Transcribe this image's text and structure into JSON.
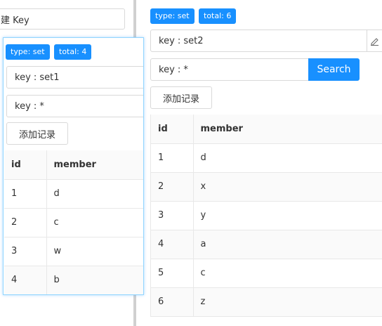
{
  "left_panel": {
    "new_key_label": "建 Key"
  },
  "popup": {
    "type_tag": "type: set",
    "total_tag": "total: 4",
    "key_value": "key : set1",
    "search_value": "key : *",
    "add_button": "添加记录",
    "columns": {
      "id": "id",
      "member": "member"
    },
    "rows": [
      {
        "id": "1",
        "member": "d"
      },
      {
        "id": "2",
        "member": "c"
      },
      {
        "id": "3",
        "member": "w"
      },
      {
        "id": "4",
        "member": "b"
      }
    ]
  },
  "right_panel": {
    "type_tag": "type: set",
    "total_tag": "total: 6",
    "key_value": "key : set2",
    "search_value": "key : *",
    "search_button": "Search",
    "add_button": "添加记录",
    "columns": {
      "id": "id",
      "member": "member"
    },
    "rows": [
      {
        "id": "1",
        "member": "d"
      },
      {
        "id": "2",
        "member": "x"
      },
      {
        "id": "3",
        "member": "y"
      },
      {
        "id": "4",
        "member": "a"
      },
      {
        "id": "5",
        "member": "c"
      },
      {
        "id": "6",
        "member": "z"
      }
    ]
  },
  "icons": {
    "edit": "pencil-edit-icon"
  },
  "colors": {
    "accent": "#1890ff",
    "popup_border": "#91d5ff"
  }
}
